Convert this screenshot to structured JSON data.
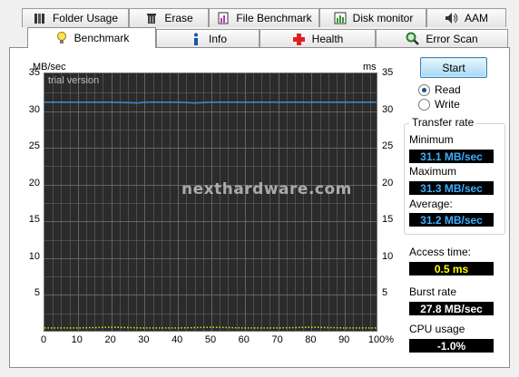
{
  "tabs_top": [
    {
      "label": "Folder Usage",
      "icon": "folder-usage-icon"
    },
    {
      "label": "Erase",
      "icon": "trash-icon"
    },
    {
      "label": "File Benchmark",
      "icon": "file-benchmark-icon"
    },
    {
      "label": "Disk monitor",
      "icon": "disk-monitor-icon"
    },
    {
      "label": "AAM",
      "icon": "speaker-icon"
    }
  ],
  "tabs_bottom": [
    {
      "label": "Benchmark",
      "icon": "lightbulb-icon",
      "active": true
    },
    {
      "label": "Info",
      "icon": "info-icon"
    },
    {
      "label": "Health",
      "icon": "health-cross-icon"
    },
    {
      "label": "Error Scan",
      "icon": "magnifier-icon"
    }
  ],
  "graph": {
    "y_unit_left": "MB/sec",
    "y_unit_right": "ms",
    "trial_text": "trial version",
    "watermark": "nexthardware.com"
  },
  "controls": {
    "start_label": "Start",
    "read_label": "Read",
    "write_label": "Write",
    "selected": "Read"
  },
  "transfer_rate": {
    "title": "Transfer rate",
    "minimum_label": "Minimum",
    "minimum_value": "31.1 MB/sec",
    "maximum_label": "Maximum",
    "maximum_value": "31.3 MB/sec",
    "average_label": "Average:",
    "average_value": "31.2 MB/sec"
  },
  "stats": {
    "access_label": "Access time:",
    "access_value": "0.5 ms",
    "burst_label": "Burst rate",
    "burst_value": "27.8 MB/sec",
    "cpu_label": "CPU usage",
    "cpu_value": "-1.0%"
  },
  "colors": {
    "transfer_line": "#3a8fd8",
    "access_dots": "#e8e800",
    "grid": "#6a6a6a",
    "graph_bg": "#2b2b2b"
  },
  "chart_data": {
    "type": "line",
    "x_ticks": [
      "0",
      "10",
      "20",
      "30",
      "40",
      "50",
      "60",
      "70",
      "80",
      "90",
      "100%"
    ],
    "y_ticks_left": [
      "35",
      "30",
      "25",
      "20",
      "15",
      "10",
      "5"
    ],
    "y_ticks_right": [
      "35",
      "30",
      "25",
      "20",
      "15",
      "10",
      "5"
    ],
    "ylim": [
      0,
      35
    ],
    "xlim": [
      0,
      100
    ],
    "series": [
      {
        "x": [
          0,
          10,
          20,
          28,
          30,
          40,
          45,
          50,
          60,
          70,
          80,
          90,
          100
        ],
        "y": [
          31.2,
          31.2,
          31.2,
          31.1,
          31.2,
          31.2,
          31.1,
          31.2,
          31.2,
          31.2,
          31.2,
          31.2,
          31.2
        ]
      },
      {
        "x": [
          0,
          10,
          20,
          30,
          40,
          50,
          60,
          70,
          80,
          90,
          100
        ],
        "y": [
          0.5,
          0.5,
          0.6,
          0.5,
          0.5,
          0.6,
          0.5,
          0.5,
          0.6,
          0.5,
          0.5
        ]
      }
    ]
  }
}
